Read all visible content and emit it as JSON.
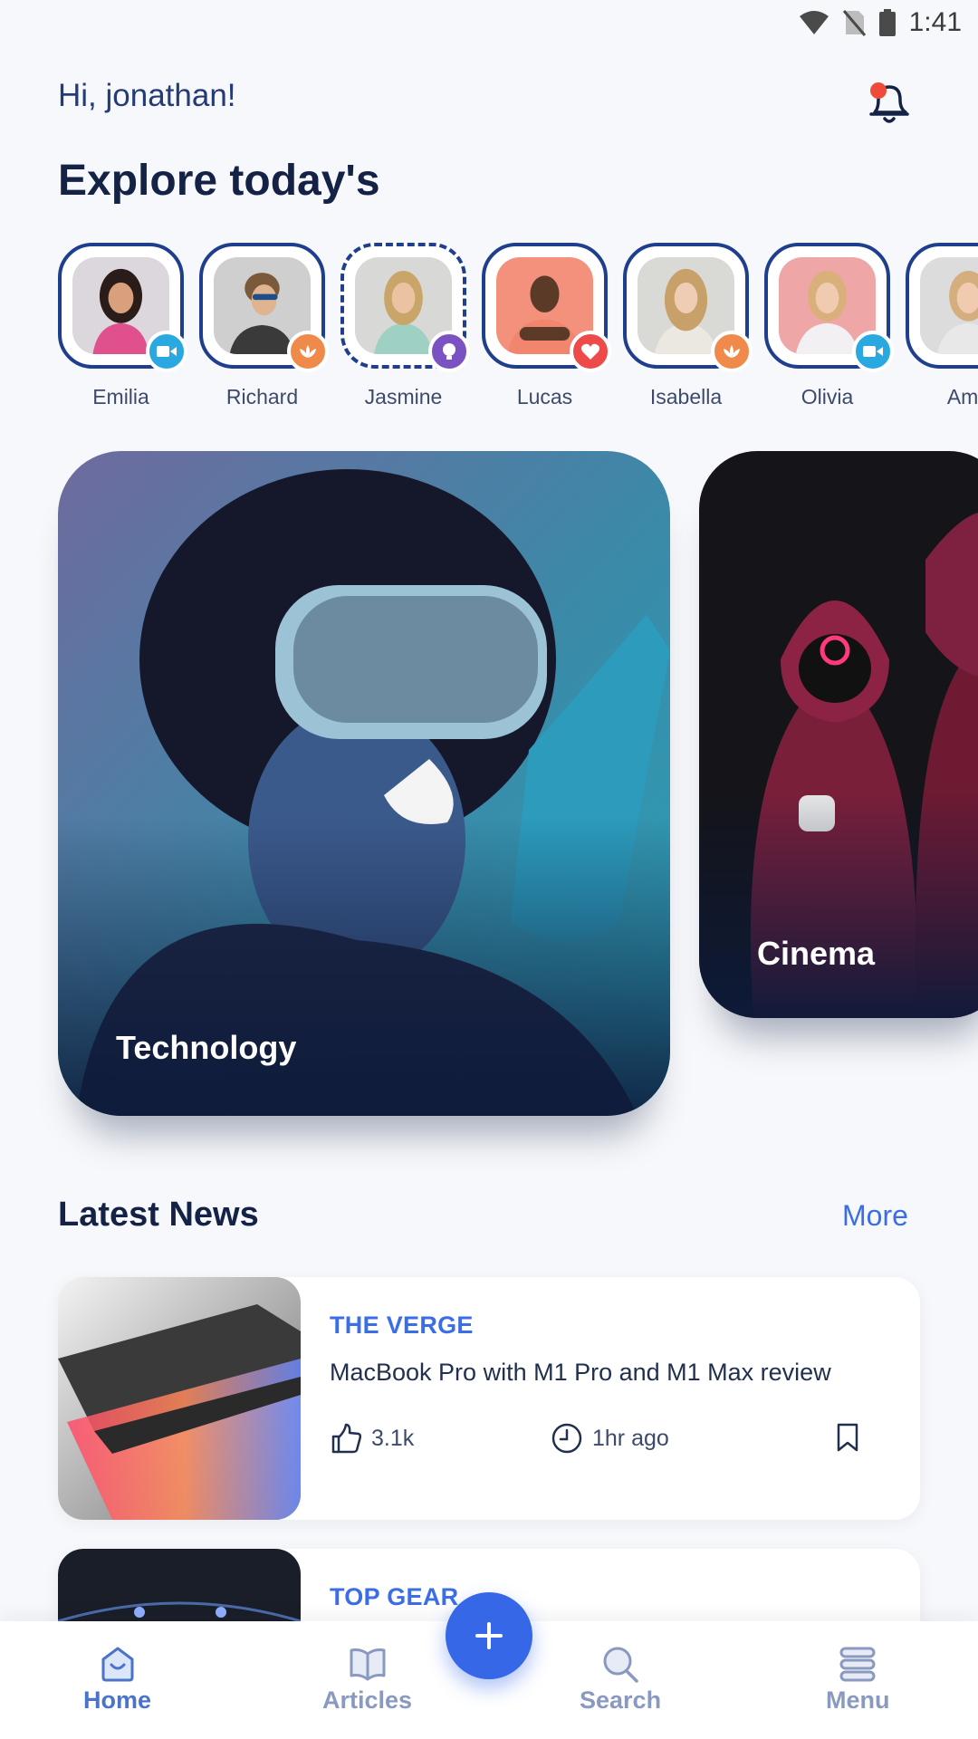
{
  "status_bar": {
    "time": "1:41",
    "icons": [
      "wifi-icon",
      "no-sim-icon",
      "battery-icon"
    ]
  },
  "header": {
    "greeting": "Hi, jonathan!",
    "title": "Explore today's",
    "notification_icon": "bell-icon"
  },
  "stories": [
    {
      "name": "Emilia",
      "badge": "video-icon",
      "badge_color": "#2aa8e0",
      "bg": "#dcd7dc"
    },
    {
      "name": "Richard",
      "badge": "lotus-icon",
      "badge_color": "#f08a4b",
      "bg": "#cfcfcf"
    },
    {
      "name": "Jasmine",
      "badge": "lightbulb-icon",
      "badge_color": "#7b52c2",
      "bg": "#d8d8d6"
    },
    {
      "name": "Lucas",
      "badge": "heart-icon",
      "badge_color": "#ef4a4a",
      "bg": "#f4917c"
    },
    {
      "name": "Isabella",
      "badge": "lotus-icon",
      "badge_color": "#f08a4b",
      "bg": "#d9d9d6"
    },
    {
      "name": "Olivia",
      "badge": "video-icon",
      "badge_color": "#2aa8e0",
      "bg": "#eea6a6"
    },
    {
      "name": "Ame",
      "badge": "",
      "badge_color": "",
      "bg": "#dcdcdc"
    }
  ],
  "categories": [
    {
      "label": "Technology"
    },
    {
      "label": "Cinema"
    }
  ],
  "latest_news": {
    "title": "Latest News",
    "more_label": "More",
    "items": [
      {
        "source": "THE VERGE",
        "headline": "MacBook Pro with M1 Pro and M1 Max review",
        "likes": "3.1k",
        "time": "1hr ago"
      },
      {
        "source": "TOP GEAR"
      }
    ]
  },
  "nav": {
    "items": [
      {
        "label": "Home",
        "icon": "home-icon",
        "active": true
      },
      {
        "label": "Articles",
        "icon": "book-icon",
        "active": false
      },
      {
        "label": "Search",
        "icon": "search-icon",
        "active": false
      },
      {
        "label": "Menu",
        "icon": "menu-icon",
        "active": false
      }
    ],
    "fab_icon": "plus-icon"
  },
  "colors": {
    "accent": "#3b6ee6",
    "navy": "#142245",
    "fab": "#3567e6"
  }
}
